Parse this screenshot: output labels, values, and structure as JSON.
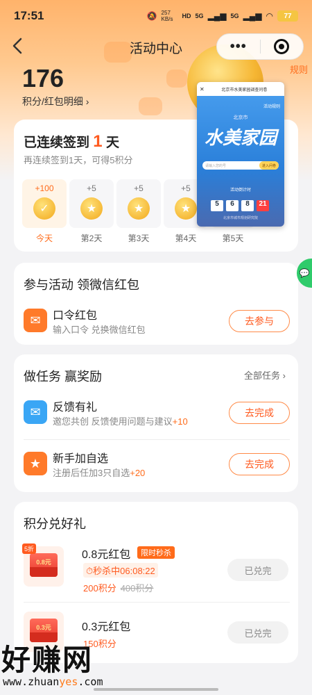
{
  "status_bar": {
    "time": "17:51",
    "net_speed": "257 KB/s",
    "hd": "HD",
    "signal1": "5G",
    "signal2": "5G",
    "battery": "77"
  },
  "nav": {
    "title": "活动中心",
    "more": "•••"
  },
  "points": {
    "value": "176",
    "detail_label": "积分/红包明细 ›",
    "rules_link": "规则"
  },
  "checkin": {
    "title_prefix": "已连续签到",
    "days": "1",
    "title_suffix": "天",
    "subtitle": "再连续签到1天，可得5积分",
    "days_list": [
      {
        "points": "+100",
        "label": "今天"
      },
      {
        "points": "+5",
        "label": "第2天"
      },
      {
        "points": "+5",
        "label": "第3天"
      },
      {
        "points": "+5",
        "label": "第4天"
      },
      {
        "points": "",
        "label": "第5天"
      }
    ]
  },
  "popup": {
    "title": "北京市水美家园调查问卷",
    "rule": "活动规则",
    "city": "北京市",
    "big_text": "水美家园",
    "search_placeholder": "请输入您的号",
    "enter_label": "进入问卷",
    "count_label": "活动倒计时",
    "digits": [
      "5",
      "6",
      "8",
      "21"
    ],
    "footer": "北京市城市规划研究院"
  },
  "activity": {
    "title": "参与活动 领微信红包",
    "item": {
      "title": "口令红包",
      "subtitle": "输入口令 兑换微信红包",
      "button": "去参与"
    }
  },
  "tasks": {
    "title": "做任务 赢奖励",
    "all_link": "全部任务 ›",
    "items": [
      {
        "title": "反馈有礼",
        "subtitle": "邀您共创 反馈使用问题与建议",
        "bonus": "+10",
        "button": "去完成"
      },
      {
        "title": "新手加自选",
        "subtitle": "注册后任加3只自选",
        "bonus": "+20",
        "button": "去完成"
      }
    ]
  },
  "exchange": {
    "title": "积分兑好礼",
    "items": [
      {
        "thumb_value": "0.8元",
        "discount": "5折",
        "title": "0.8元红包",
        "tag": "限时秒杀",
        "countdown": "秒杀中06:08:22",
        "price": "200积分",
        "orig_price": "400积分",
        "button": "已兑完"
      },
      {
        "thumb_value": "0.3元",
        "title": "0.3元红包",
        "price": "150积分",
        "button": "已兑完"
      }
    ]
  },
  "watermark": {
    "main": "好赚网",
    "url_a": "www.zhuan",
    "url_b": "yes",
    "url_c": ".com"
  }
}
